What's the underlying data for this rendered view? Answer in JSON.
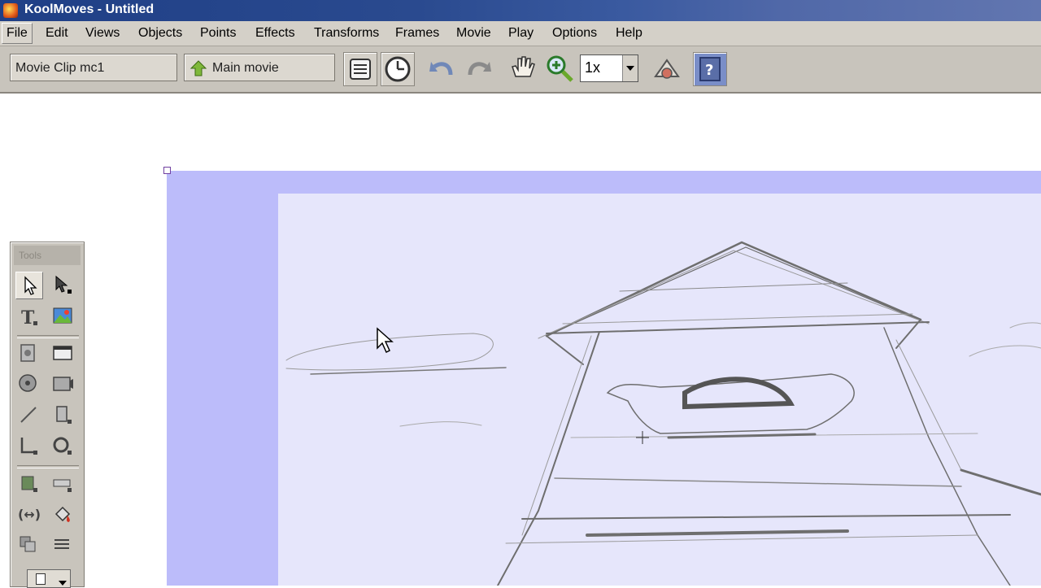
{
  "window": {
    "title": "KoolMoves - Untitled"
  },
  "menu": {
    "items": [
      "File",
      "Edit",
      "Views",
      "Objects",
      "Points",
      "Effects",
      "Transforms",
      "Frames",
      "Movie",
      "Play",
      "Options",
      "Help"
    ]
  },
  "toolbar": {
    "clip_name": "Movie Clip mc1",
    "main_movie_label": "Main movie",
    "zoom_value": "1x"
  },
  "toolbox": {
    "header": "Tools"
  },
  "colors": {
    "stage_border": "#bcbcfa",
    "stage_fill": "#e6e6fb",
    "chrome": "#d4d0c8"
  }
}
